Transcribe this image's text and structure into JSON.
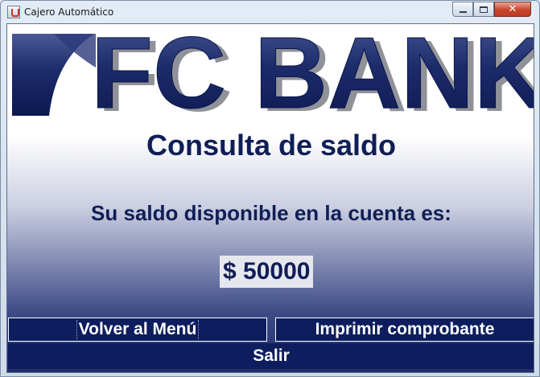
{
  "window": {
    "title": "Cajero Automático"
  },
  "logo": {
    "text": "FC BANK",
    "color": "#1a2a6c"
  },
  "main": {
    "heading": "Consulta de saldo",
    "subtitle": "Su saldo disponible en la cuenta es:",
    "balance": "$ 50000"
  },
  "buttons": {
    "back": "Volver al Menú",
    "print": "Imprimir comprobante",
    "exit": "Salir"
  },
  "colors": {
    "accent": "#0d1d5e",
    "text": "#0f1e56"
  }
}
